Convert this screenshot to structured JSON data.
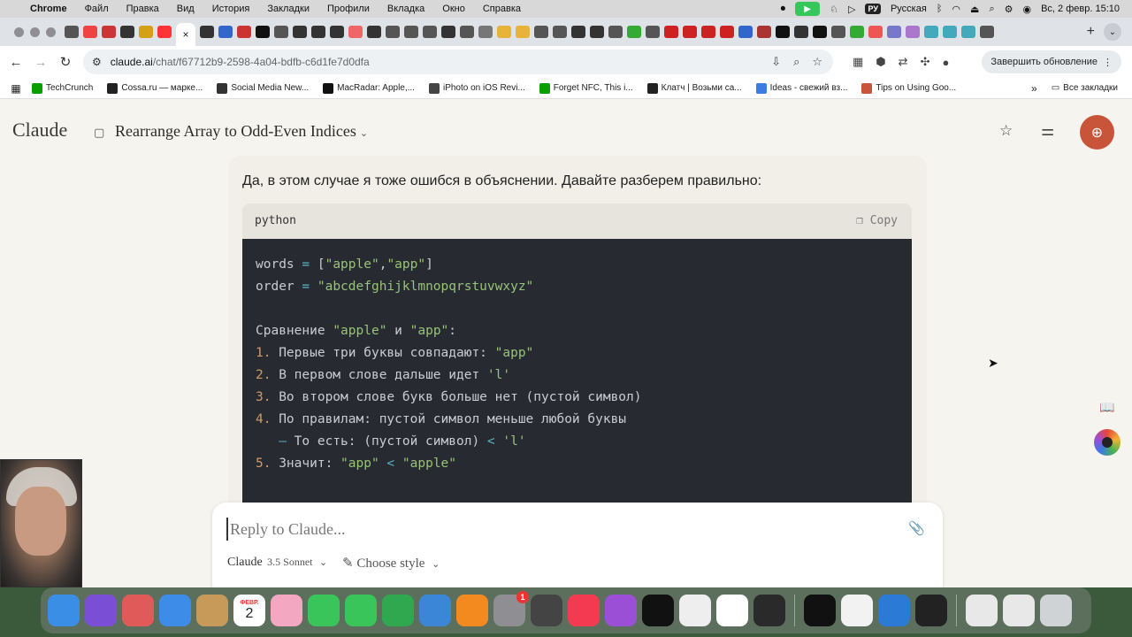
{
  "menubar": {
    "app": "Chrome",
    "items": [
      "Файл",
      "Правка",
      "Вид",
      "История",
      "Закладки",
      "Профили",
      "Вкладка",
      "Окно",
      "Справка"
    ],
    "lang": "РУ",
    "lang_name": "Русская",
    "datetime": "Вс, 2 февр.  15:10"
  },
  "toolbar": {
    "url_host": "claude.ai",
    "url_path": "/chat/f67712b9-2598-4a04-bdfb-c6d1fe7d0dfa",
    "update_label": "Завершить обновление"
  },
  "bookmarks": {
    "items": [
      {
        "label": "TechCrunch",
        "color": "#0a9e01"
      },
      {
        "label": "Cossa.ru — марке...",
        "color": "#222222"
      },
      {
        "label": "Social Media New...",
        "color": "#333333"
      },
      {
        "label": "MacRadar: Apple,...",
        "color": "#111111"
      },
      {
        "label": "iPhoto on iOS Revi...",
        "color": "#444444"
      },
      {
        "label": "Forget NFC, This i...",
        "color": "#0a9e01"
      },
      {
        "label": "Клатч | Возьми са...",
        "color": "#222222"
      },
      {
        "label": "Ideas - свежий вз...",
        "color": "#3d7be0"
      },
      {
        "label": "Tips on Using Goo...",
        "color": "#c8553a"
      }
    ],
    "all_label": "Все закладки"
  },
  "header": {
    "logo": "Claude",
    "chat_title": "Rearrange Array to Odd-Even Indices"
  },
  "message": {
    "text": "Да, в этом случае я тоже ошибся в объяснении. Давайте разберем правильно:",
    "code_lang": "python",
    "copy_label": "Copy",
    "code": {
      "l1a": "words ",
      "l1b": "= ",
      "l1c": "[",
      "l1d": "\"apple\"",
      "l1e": ",",
      "l1f": "\"app\"",
      "l1g": "]",
      "l2a": "order ",
      "l2b": "= ",
      "l2c": "\"abcdefghijklmnopqrstuvwxyz\"",
      "l4a": "Сравнение ",
      "l4b": "\"apple\"",
      "l4c": " и ",
      "l4d": "\"app\"",
      "l4e": ":",
      "l5a": "1. ",
      "l5b": "Первые три буквы совпадают: ",
      "l5c": "\"app\"",
      "l6a": "2. ",
      "l6b": "В первом слове дальше идет ",
      "l6c": "'l'",
      "l7a": "3. ",
      "l7b": "Во втором слове букв больше нет (пустой символ)",
      "l8a": "4. ",
      "l8b": "По правилам: пустой символ меньше любой буквы",
      "l9a": "   – ",
      "l9b": "То есть: (пустой символ) ",
      "l9c": "<",
      "l9d": " 'l'",
      "l10a": "5. ",
      "l10b": "Значит: ",
      "l10c": "\"app\"",
      "l10d": " < ",
      "l10e": "\"apple\""
    }
  },
  "composer": {
    "placeholder": "Reply to Claude...",
    "model_name": "Claude",
    "model_version": "3.5 Sonnet",
    "style_label": "Choose style"
  },
  "dock": {
    "calendar_month": "ФЕВР.",
    "calendar_day": "2",
    "badge_count": "1",
    "apps": [
      "finder",
      "siri",
      "launchpad",
      "mail",
      "contacts",
      "calendar",
      "photos",
      "facetime",
      "messages",
      "numbers",
      "keynote",
      "books",
      "system-settings",
      "quicktime",
      "music",
      "podcasts",
      "tv",
      "textedit",
      "freeform",
      "simulator",
      "epic-games",
      "chrome",
      "vscode",
      "terminal"
    ]
  }
}
